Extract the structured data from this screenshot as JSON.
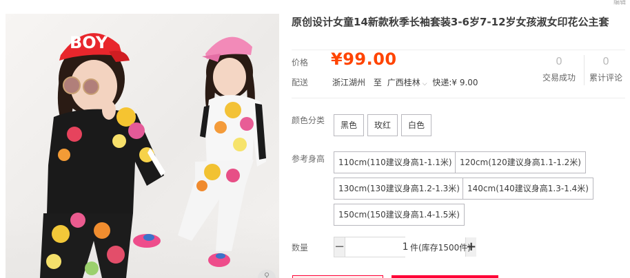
{
  "corner_text": "编辑",
  "product": {
    "title": "原创设计女童14新款秋季长袖套装3-6岁7-12岁女孩淑女印花公主套"
  },
  "price": {
    "label": "价格",
    "value": "¥99.00"
  },
  "shipping": {
    "label": "配送",
    "from": "浙江湖州",
    "to_prefix": "至",
    "to": "广西桂林",
    "method": "快递:¥ 9.00"
  },
  "stats": [
    {
      "num": "0",
      "label": "交易成功"
    },
    {
      "num": "0",
      "label": "累计评论"
    }
  ],
  "color": {
    "label": "颜色分类",
    "options": [
      "黑色",
      "玫红",
      "白色"
    ]
  },
  "size": {
    "label": "参考身高",
    "options": [
      "110cm(110建议身高1-1.1米)",
      "120cm(120建议身高1.1-1.2米)",
      "130cm(130建议身高1.2-1.3米)",
      "140cm(140建议身高1.3-1.4米)",
      "150cm(150建议身高1.4-1.5米)"
    ]
  },
  "quantity": {
    "label": "数量",
    "value": "1",
    "minus": "−",
    "plus": "+",
    "stock": "件(库存1500件)"
  },
  "image": {
    "cap_text": "BOY",
    "colors": {
      "accent": "#ff4400",
      "cap_red": "#e8262c",
      "cap_pink": "#f28ab8"
    }
  }
}
